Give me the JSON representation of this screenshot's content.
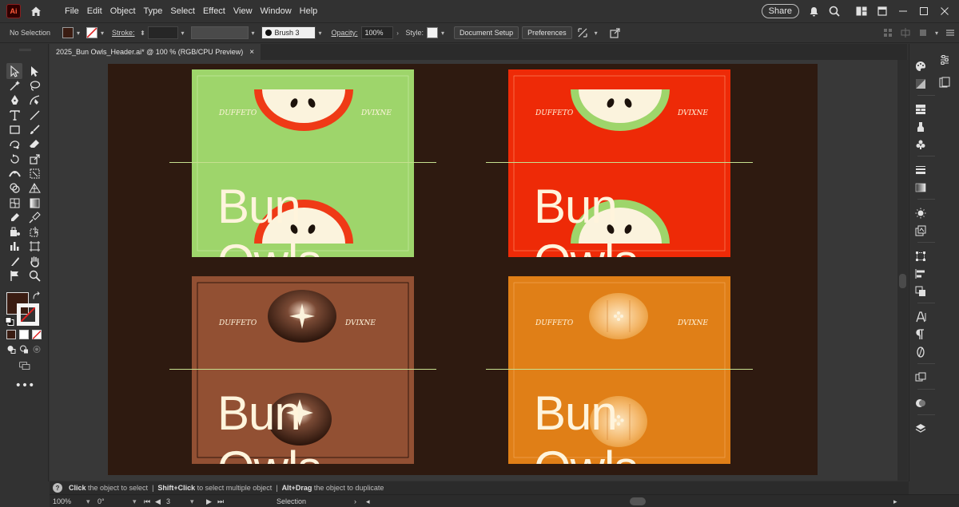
{
  "menubar": {
    "logo": "Ai",
    "items": [
      "File",
      "Edit",
      "Object",
      "Type",
      "Select",
      "Effect",
      "View",
      "Window",
      "Help"
    ],
    "share": "Share"
  },
  "controlbar": {
    "selection": "No Selection",
    "stroke_label": "Stroke:",
    "brush": "Brush 3",
    "opacity_label": "Opacity:",
    "opacity_value": "100%",
    "style_label": "Style:",
    "document_setup": "Document Setup",
    "preferences": "Preferences",
    "fill_color": "#3a1c12"
  },
  "tab": {
    "title": "2025_Bun Owls_Header.ai* @ 100 % (RGB/CPU Preview)",
    "close": "×"
  },
  "artboards": [
    {
      "name": "green",
      "bg": "#9ed56b",
      "accent": "#ef3a16",
      "brand": "Bun Owls",
      "left": "DUFFETO",
      "right": "DVIXNE"
    },
    {
      "name": "red",
      "bg": "#ee2a07",
      "accent": "#9ed56b",
      "brand": "Bun Owls",
      "left": "DUFFETO",
      "right": "DVIXNE"
    },
    {
      "name": "brown",
      "bg": "#925033",
      "accent": "#3a1c12",
      "brand": "Bun Owls",
      "left": "DUFFETO",
      "right": "DVIXNE"
    },
    {
      "name": "orange",
      "bg": "#e07f17",
      "accent": "#f0b060",
      "brand": "Bun Owls",
      "left": "DUFFETO",
      "right": "DVIXNE"
    }
  ],
  "status": {
    "click": "Click",
    "click_text": " the object to select  |  ",
    "shift_click": "Shift+Click",
    "shift_text": " to select multiple object  |  ",
    "alt_drag": "Alt+Drag",
    "alt_text": " the object to duplicate"
  },
  "bottombar": {
    "zoom": "100%",
    "rotation": "0°",
    "artboard_index": "3",
    "mode": "Selection"
  }
}
